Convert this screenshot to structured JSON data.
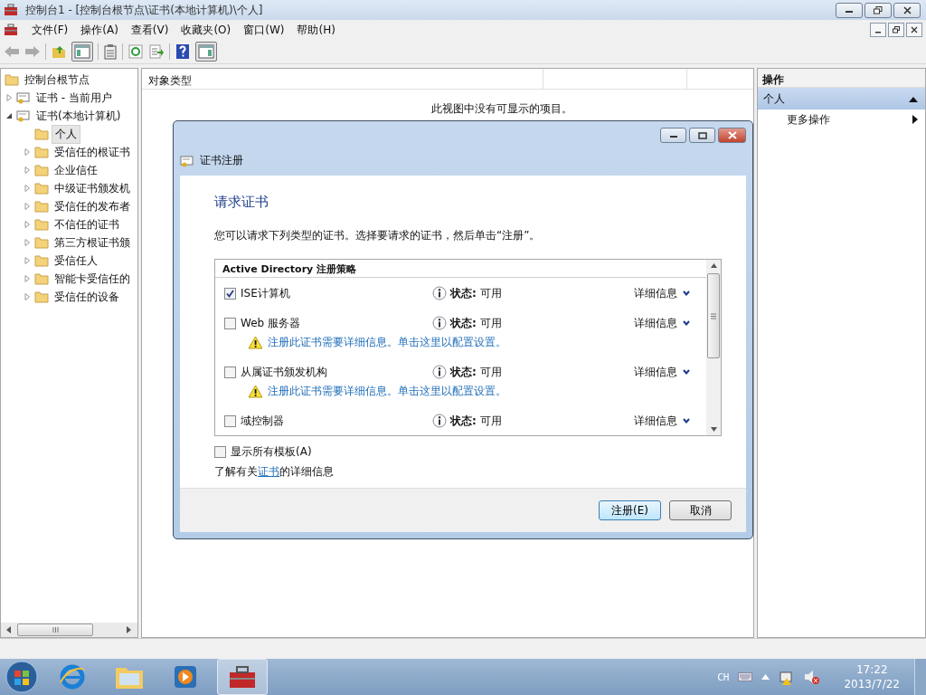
{
  "window": {
    "title": "控制台1 - [控制台根节点\\证书(本地计算机)\\个人]"
  },
  "menu": [
    "文件(F)",
    "操作(A)",
    "查看(V)",
    "收藏夹(O)",
    "窗口(W)",
    "帮助(H)"
  ],
  "tree": {
    "label": "控制台根节点",
    "children": [
      {
        "label": "证书 - 当前用户",
        "kind": "cert",
        "expanded": false,
        "selected": false
      },
      {
        "label": "证书(本地计算机)",
        "kind": "cert",
        "expanded": true,
        "selected": false,
        "children": [
          {
            "label": "个人",
            "kind": "leaf",
            "selected": true
          },
          {
            "label": "受信任的根证书",
            "kind": "folder",
            "expanded": false,
            "selected": false
          },
          {
            "label": "企业信任",
            "kind": "folder",
            "expanded": false,
            "selected": false
          },
          {
            "label": "中级证书颁发机",
            "kind": "folder",
            "expanded": false,
            "selected": false
          },
          {
            "label": "受信任的发布者",
            "kind": "folder",
            "expanded": false,
            "selected": false
          },
          {
            "label": "不信任的证书",
            "kind": "folder",
            "expanded": false,
            "selected": false
          },
          {
            "label": "第三方根证书颁",
            "kind": "folder",
            "expanded": false,
            "selected": false
          },
          {
            "label": "受信任人",
            "kind": "folder",
            "expanded": false,
            "selected": false
          },
          {
            "label": "智能卡受信任的",
            "kind": "folder",
            "expanded": false,
            "selected": false
          },
          {
            "label": "受信任的设备",
            "kind": "folder",
            "expanded": false,
            "selected": false
          }
        ]
      }
    ]
  },
  "center": {
    "columns": [
      "对象类型"
    ],
    "empty_message": "此视图中没有可显示的项目。"
  },
  "actions": {
    "header": "操作",
    "section": "个人",
    "items": [
      "更多操作"
    ]
  },
  "dialog": {
    "title": "证书注册",
    "heading": "请求证书",
    "description": "您可以请求下列类型的证书。选择要请求的证书，然后单击“注册”。",
    "list_header": "Active Directory 注册策略",
    "templates": [
      {
        "name": "ISE计算机",
        "checked": true,
        "status_label": "状态:",
        "status": "可用",
        "details": "详细信息"
      },
      {
        "name": "Web 服务器",
        "checked": false,
        "status_label": "状态:",
        "status": "可用",
        "details": "详细信息",
        "warning": "注册此证书需要详细信息。单击这里以配置设置。"
      },
      {
        "name": "从属证书颁发机构",
        "checked": false,
        "status_label": "状态:",
        "status": "可用",
        "details": "详细信息",
        "warning": "注册此证书需要详细信息。单击这里以配置设置。"
      },
      {
        "name": "域控制器",
        "checked": false,
        "status_label": "状态:",
        "status": "可用",
        "details": "详细信息"
      }
    ],
    "show_all": {
      "label": "显示所有模板(A)",
      "checked": false
    },
    "learn_more": {
      "before": "了解有关",
      "link": "证书",
      "after": "的详细信息"
    },
    "buttons": [
      {
        "label": "注册(E)",
        "default": true
      },
      {
        "label": "取消",
        "default": false
      }
    ]
  },
  "taskbar": {
    "language": "CH",
    "time": "17:22",
    "date": "2013/7/22"
  }
}
